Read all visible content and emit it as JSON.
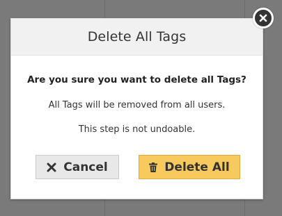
{
  "dialog": {
    "title": "Delete All Tags",
    "question": "Are you sure you want to delete all Tags?",
    "info_line_1": "All Tags will be removed from all users.",
    "info_line_2": "This step is not undoable.",
    "cancel_label": "Cancel",
    "cancel_icon": "times-icon",
    "delete_label": "Delete All",
    "delete_icon": "trash-icon",
    "close_icon": "close-circle-icon"
  },
  "colors": {
    "overlay": "#7a7a7a",
    "header_bg": "#f1f1f1",
    "cancel_bg": "#e8e8e8",
    "delete_bg": "#f8c95c",
    "text": "#333333"
  }
}
